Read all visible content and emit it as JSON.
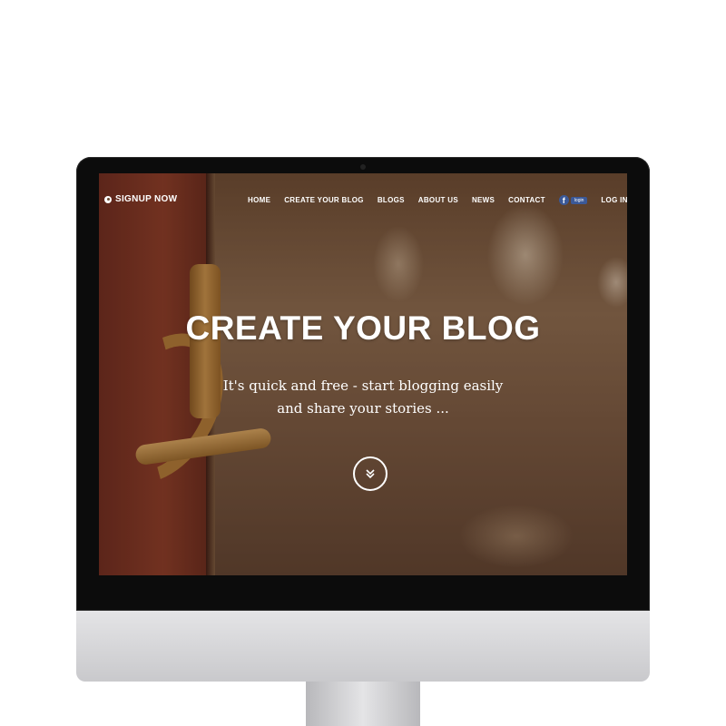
{
  "nav": {
    "brand": "SIGNUP NOW",
    "items": [
      "HOME",
      "CREATE YOUR BLOG",
      "BLOGS",
      "ABOUT US",
      "NEWS",
      "CONTACT"
    ],
    "fb_login": "login",
    "login": "LOG IN"
  },
  "hero": {
    "title": "CREATE YOUR BLOG",
    "subtitle_line1": "It's quick and free - start blogging easily",
    "subtitle_line2": "and share your stories ..."
  },
  "colors": {
    "facebook": "#3b5998",
    "text": "#ffffff"
  }
}
